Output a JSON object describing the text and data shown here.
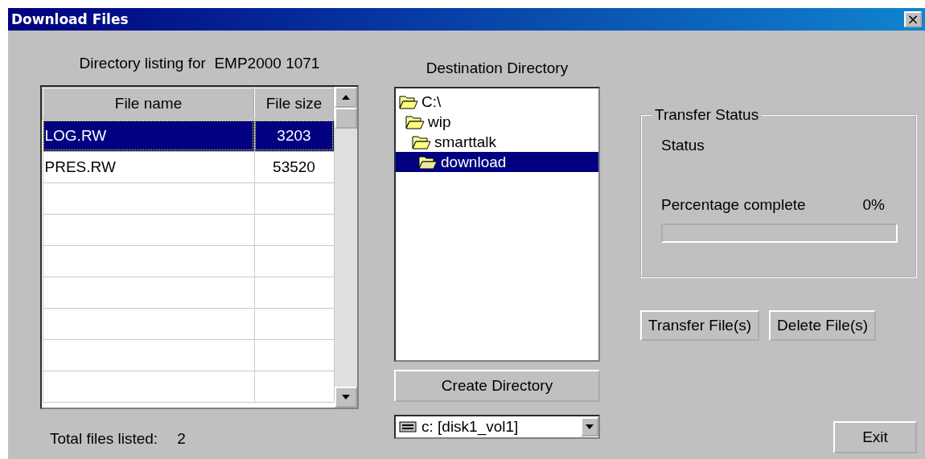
{
  "window": {
    "title": "Download Files",
    "close": "×"
  },
  "listing": {
    "label": "Directory listing for  EMP2000 1071",
    "columns": [
      "File name",
      "File size"
    ],
    "rows": [
      {
        "name": "LOG.RW",
        "size": "3203",
        "selected": true
      },
      {
        "name": "PRES.RW",
        "size": "53520",
        "selected": false
      }
    ],
    "total_label": "Total files listed:",
    "total": "2"
  },
  "destination": {
    "label": "Destination Directory",
    "tree": [
      {
        "name": "C:\\",
        "selected": false,
        "children": [
          {
            "name": "wip",
            "selected": false,
            "children": [
              {
                "name": "smarttalk",
                "selected": false,
                "children": [
                  {
                    "name": "download",
                    "selected": true
                  }
                ]
              }
            ]
          }
        ]
      }
    ],
    "create_button": "Create Directory",
    "drive": "c: [disk1_vol1]"
  },
  "transfer": {
    "title": "Transfer Status",
    "status_label": "Status",
    "percent_label": "Percentage complete",
    "percent": "0%",
    "level": 0
  },
  "buttons": [
    "Transfer File(s)",
    "Delete File(s)"
  ],
  "exit_button": "Exit"
}
